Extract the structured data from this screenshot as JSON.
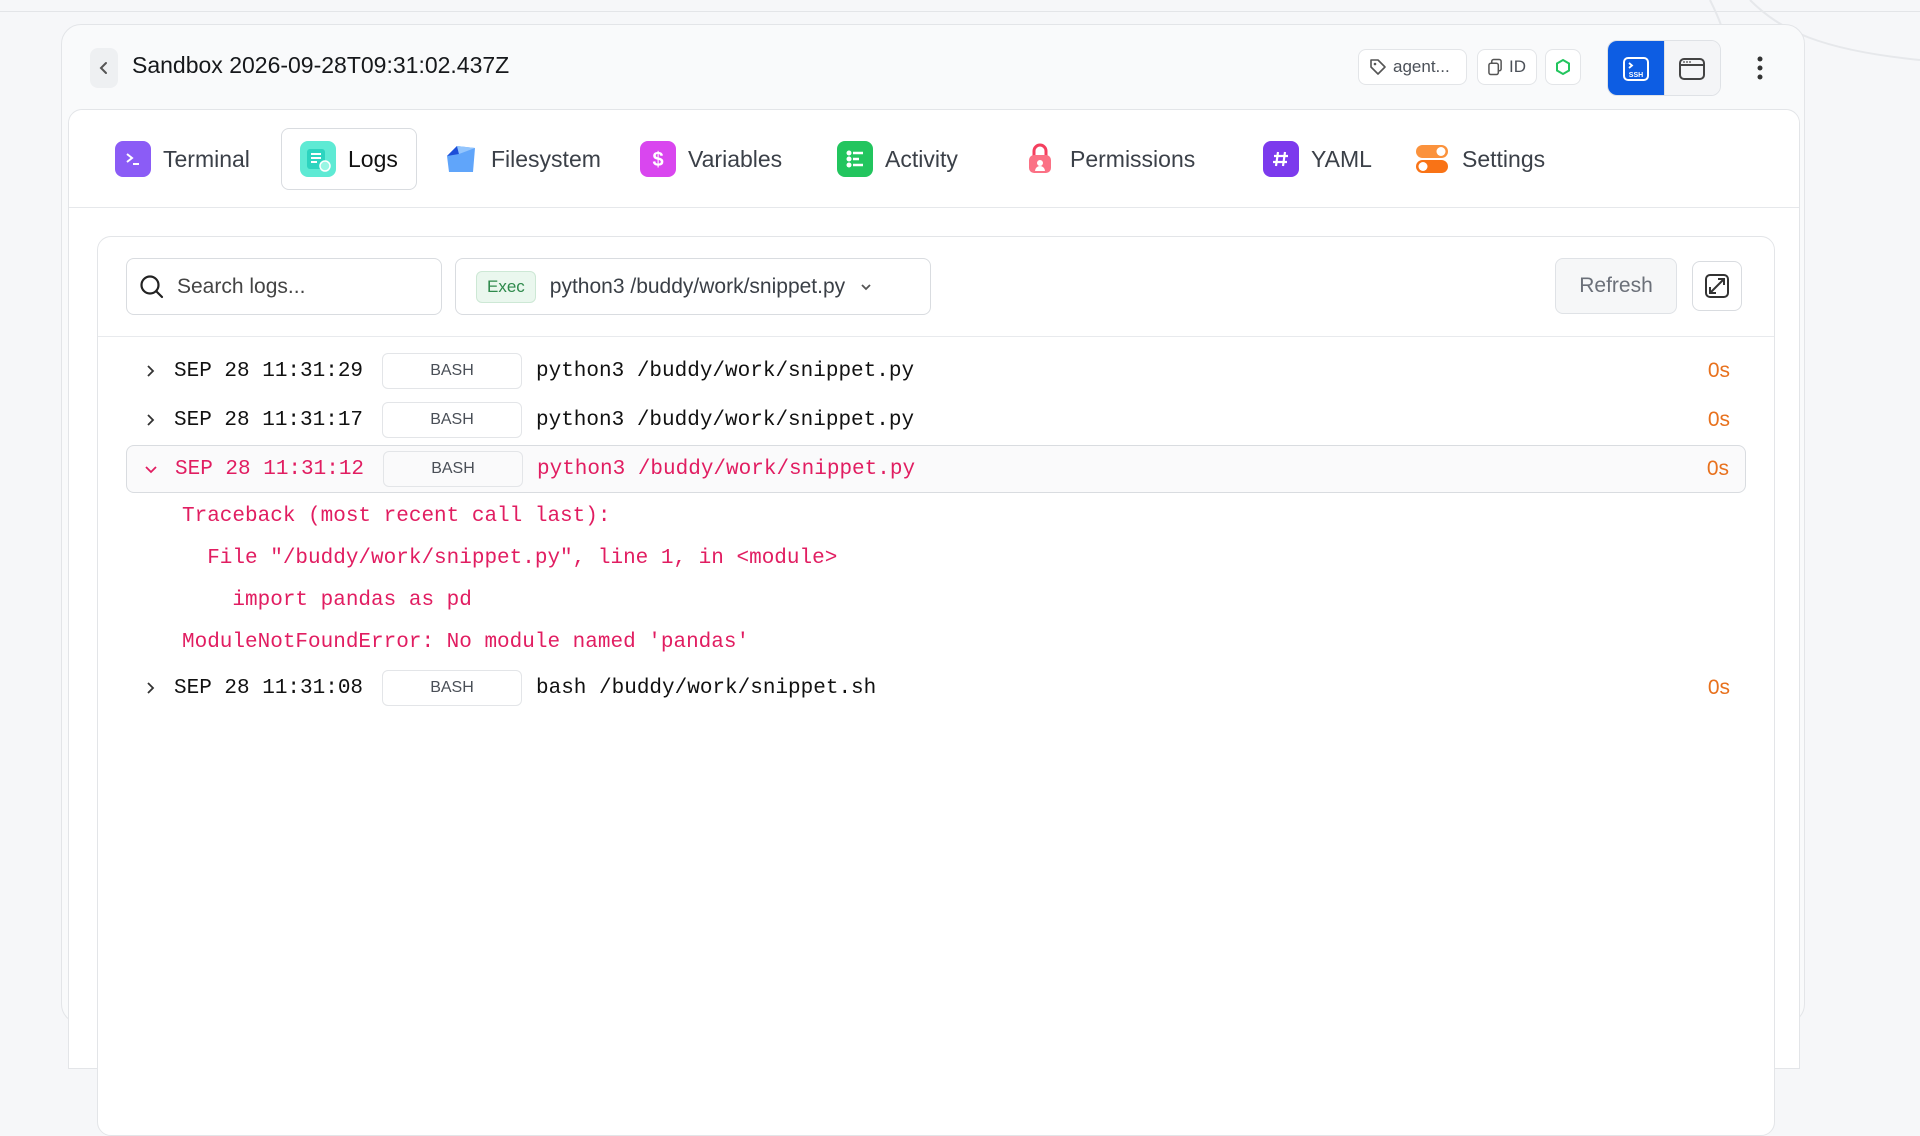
{
  "header": {
    "title": "Sandbox 2026-09-28T09:31:02.437Z",
    "tag_chip": "agent...",
    "id_chip": "ID"
  },
  "tabs": [
    {
      "label": "Terminal",
      "icon": "terminal-icon",
      "color": "#8b5cf6"
    },
    {
      "label": "Logs",
      "icon": "logs-icon",
      "color": "#14b8a6"
    },
    {
      "label": "Filesystem",
      "icon": "filesystem-icon",
      "color": "#3b82f6"
    },
    {
      "label": "Variables",
      "icon": "dollar-icon",
      "color": "#d946ef"
    },
    {
      "label": "Activity",
      "icon": "activity-icon",
      "color": "#22c55e"
    },
    {
      "label": "Permissions",
      "icon": "lock-icon",
      "color": "#f43f5e"
    },
    {
      "label": "YAML",
      "icon": "hash-icon",
      "color": "#7c3aed"
    },
    {
      "label": "Settings",
      "icon": "toggles-icon",
      "color": "#f97316"
    }
  ],
  "active_tab": "Logs",
  "toolbar": {
    "search_placeholder": "Search logs...",
    "filter_badge": "Exec",
    "filter_value": "python3 /buddy/work/snippet.py",
    "refresh_label": "Refresh"
  },
  "logs": [
    {
      "timestamp": "SEP 28 11:31:29",
      "source": "BASH",
      "command": "python3 /buddy/work/snippet.py",
      "duration": "0s",
      "expanded": false
    },
    {
      "timestamp": "SEP 28 11:31:17",
      "source": "BASH",
      "command": "python3 /buddy/work/snippet.py",
      "duration": "0s",
      "expanded": false
    },
    {
      "timestamp": "SEP 28 11:31:12",
      "source": "BASH",
      "command": "python3 /buddy/work/snippet.py",
      "duration": "0s",
      "expanded": true
    },
    {
      "timestamp": "SEP 28 11:31:08",
      "source": "BASH",
      "command": "bash /buddy/work/snippet.sh",
      "duration": "0s",
      "expanded": false
    }
  ],
  "traceback": [
    "Traceback (most recent call last):",
    "  File \"/buddy/work/snippet.py\", line 1, in <module>",
    "    import pandas as pd",
    "ModuleNotFoundError: No module named 'pandas'"
  ],
  "colors": {
    "accent_blue": "#0d5de3",
    "error_pink": "#e11d61",
    "duration_orange": "#e8711d",
    "exec_green": "#2f8a4c"
  }
}
